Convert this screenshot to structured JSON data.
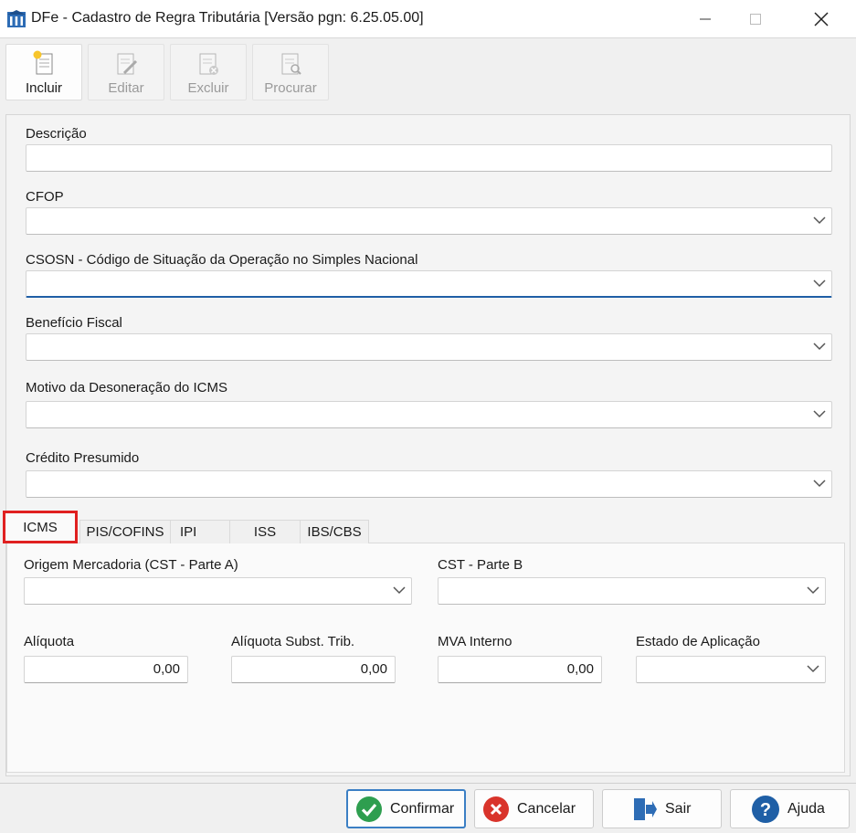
{
  "window": {
    "title": "DFe - Cadastro de Regra Tributária [Versão pgn: 6.25.05.00]",
    "app_icon": "building-icon",
    "controls": [
      "minimize-icon",
      "maximize-icon",
      "close-icon"
    ]
  },
  "toolbar": {
    "incluir": "Incluir",
    "editar": "Editar",
    "excluir": "Excluir",
    "procurar": "Procurar"
  },
  "form": {
    "descricao_label": "Descrição",
    "descricao_value": "",
    "cfop_label": "CFOP",
    "cfop_value": "",
    "csosn_label": "CSOSN - Código de Situação da Operação no Simples Nacional",
    "csosn_value": "",
    "beneficio_label": "Benefício Fiscal",
    "beneficio_value": "",
    "motivo_label": "Motivo da Desoneração do ICMS",
    "motivo_value": "",
    "credito_label": "Crédito Presumido",
    "credito_value": ""
  },
  "tabs": [
    "ICMS",
    "PIS/COFINS",
    "IPI",
    "ISS",
    "IBS/CBS"
  ],
  "selected_tab": "ICMS",
  "icms": {
    "origem_label": "Origem Mercadoria (CST - Parte A)",
    "cst_b_label": "CST - Parte B",
    "aliquota_label": "Alíquota",
    "aliquota_value": "0,00",
    "aliquota_st_label": "Alíquota Subst. Trib.",
    "aliquota_st_value": "0,00",
    "mva_label": "MVA Interno",
    "mva_value": "0,00",
    "estado_label": "Estado de Aplicação"
  },
  "buttons": {
    "confirmar": "Confirmar",
    "cancelar": "Cancelar",
    "sair": "Sair",
    "ajuda": "Ajuda"
  },
  "colors": {
    "accent": "#1f5fa6",
    "highlight": "#e02020",
    "confirm_green": "#2e9e4f",
    "cancel_red": "#d9342b",
    "help_blue": "#1f5fa6"
  }
}
